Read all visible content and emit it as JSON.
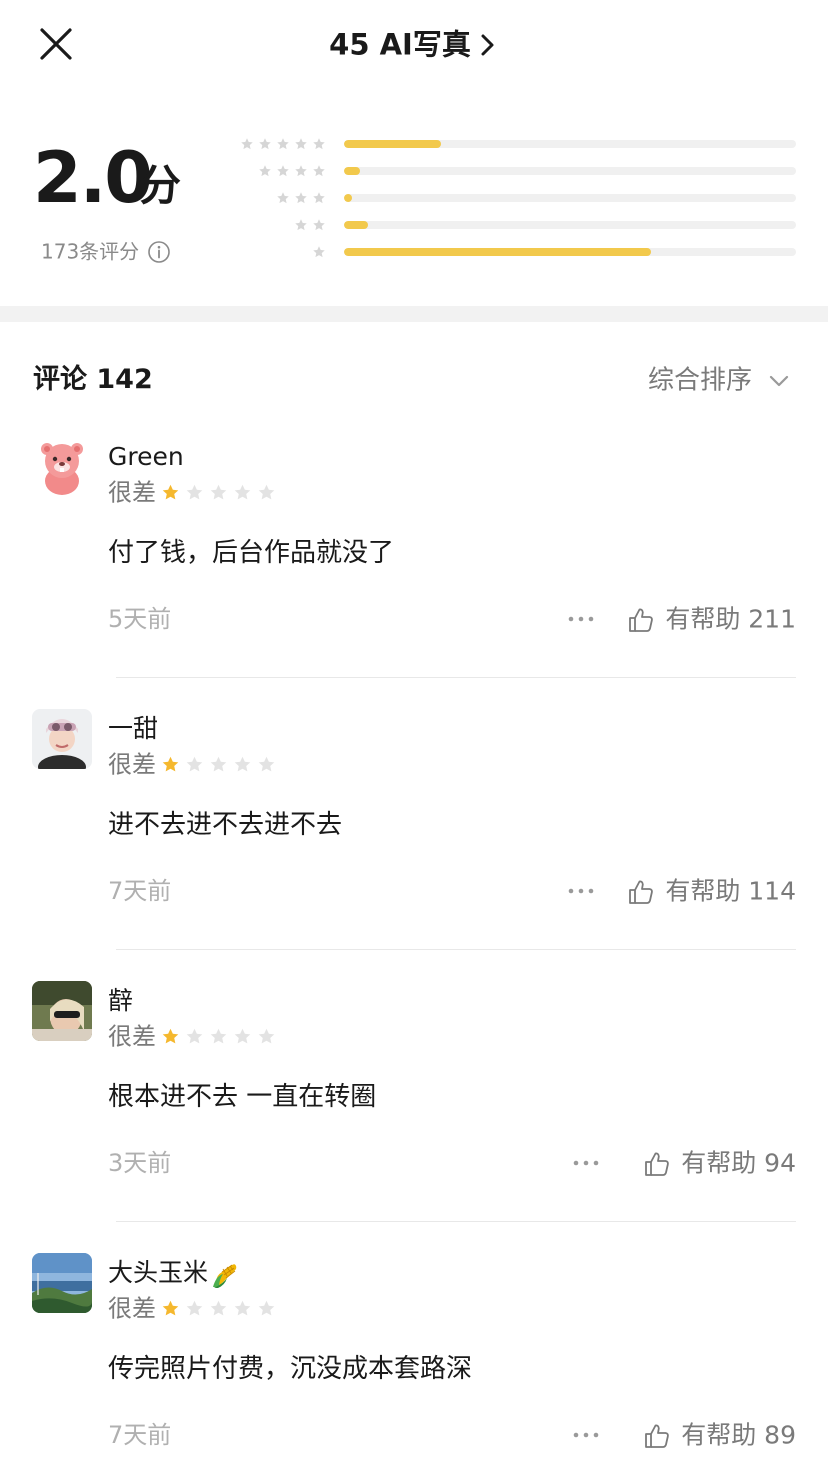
{
  "header": {
    "title": "45 AI写真"
  },
  "summary": {
    "score": "2.0",
    "score_unit": "分",
    "rating_count": "173条评分",
    "distribution": [
      {
        "stars": 5,
        "fraction": 0.215
      },
      {
        "stars": 4,
        "fraction": 0.035
      },
      {
        "stars": 3,
        "fraction": 0.018
      },
      {
        "stars": 2,
        "fraction": 0.053
      },
      {
        "stars": 1,
        "fraction": 0.68
      }
    ]
  },
  "comments": {
    "title": "评论 142",
    "sort_label": "综合排序",
    "items": [
      {
        "name": "Green",
        "rating_label": "很差",
        "stars": 1,
        "text": "付了钱，后台作品就没了",
        "time": "5天前",
        "helpful": "有帮助 211"
      },
      {
        "name": "一甜",
        "rating_label": "很差",
        "stars": 1,
        "text": "进不去进不去进不去",
        "time": "7天前",
        "helpful": "有帮助 114"
      },
      {
        "name": "辪",
        "rating_label": "很差",
        "stars": 1,
        "text": "根本进不去 一直在转圈",
        "time": "3天前",
        "helpful": "有帮助 94"
      },
      {
        "name": "大头玉米",
        "rating_label": "很差",
        "stars": 1,
        "text": "传完照片付费，沉没成本套路深",
        "time": "7天前",
        "helpful": "有帮助 89"
      }
    ]
  },
  "colors": {
    "star_filled": "#f5b82e",
    "star_empty": "#e3e3e3",
    "bar_fill": "#f2c94c",
    "bar_track": "#f0f0f0"
  },
  "icons": {
    "close": "close-icon",
    "title_chevron": "chevron-right-icon",
    "info": "info-icon",
    "sort": "chevron-down-icon",
    "more": "more-dots-icon",
    "helpful": "thumbs-up-icon",
    "corn": "corn-emoji-icon"
  }
}
